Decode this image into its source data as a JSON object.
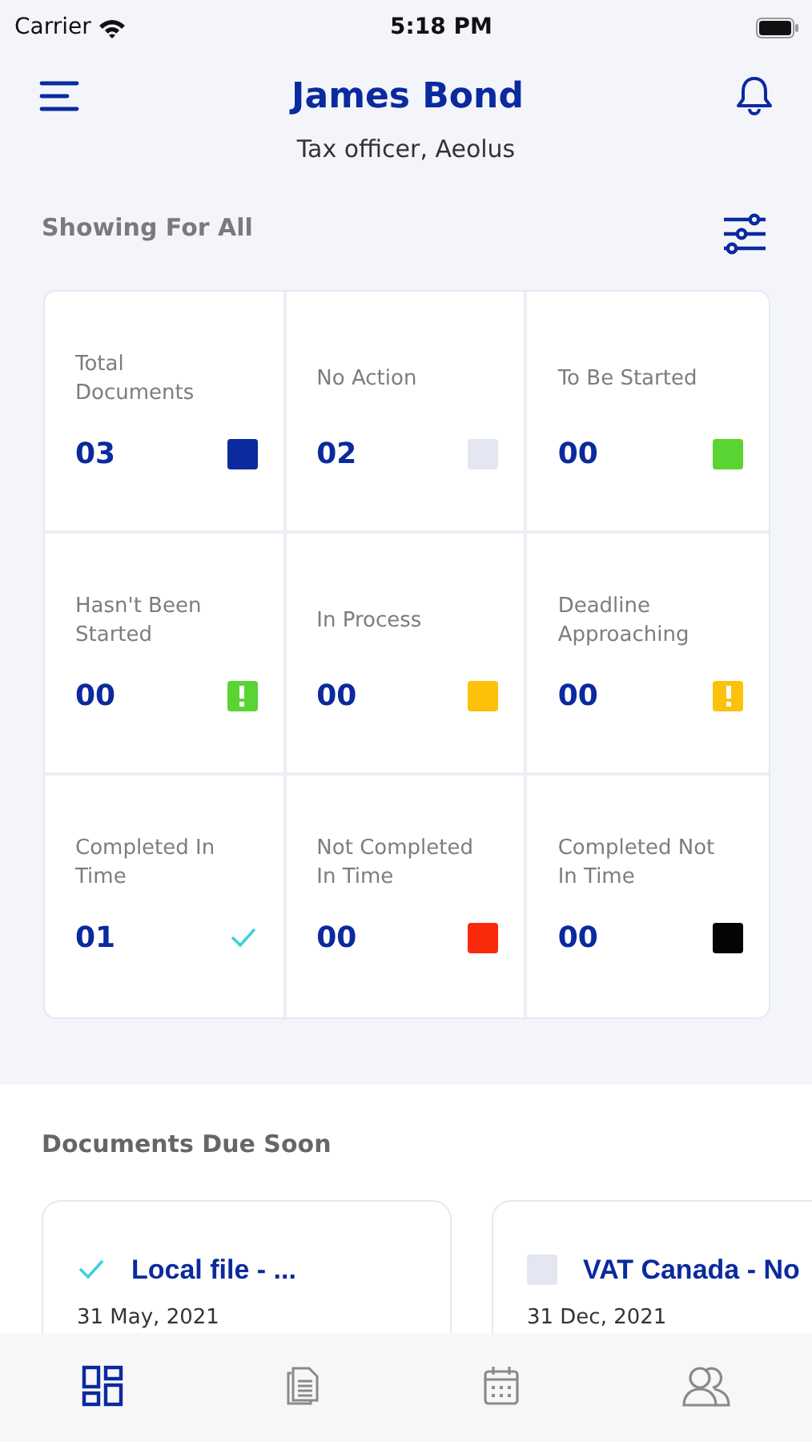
{
  "status_bar": {
    "carrier": "Carrier",
    "time": "5:18 PM"
  },
  "header": {
    "title": "James Bond",
    "subtitle": "Tax officer, Aeolus"
  },
  "filter_label": "Showing For All",
  "stats": [
    {
      "label": "Total Documents",
      "value": "03",
      "kind": "square",
      "color": "#0a2a9e"
    },
    {
      "label": "No Action",
      "value": "02",
      "kind": "square",
      "color": "#e4e6f2"
    },
    {
      "label": "To Be Started",
      "value": "00",
      "kind": "square",
      "color": "#5ad433"
    },
    {
      "label": "Hasn't Been Started",
      "value": "00",
      "kind": "alert",
      "color": "#5ad433"
    },
    {
      "label": "In Process",
      "value": "00",
      "kind": "square",
      "color": "#fcc10a"
    },
    {
      "label": "Deadline Approaching",
      "value": "00",
      "kind": "alert",
      "color": "#fcc10a"
    },
    {
      "label": "Completed In Time",
      "value": "01",
      "kind": "check",
      "color": "#3fd0dc"
    },
    {
      "label": "Not Completed In Time",
      "value": "00",
      "kind": "square",
      "color": "#f92b0c"
    },
    {
      "label": "Completed Not In Time",
      "value": "00",
      "kind": "square",
      "color": "#050505"
    }
  ],
  "due_section": {
    "title": "Documents Due Soon",
    "documents": [
      {
        "title": "Local file - ...",
        "date": "31 May, 2021",
        "kind": "check",
        "color": "#3fd0dc"
      },
      {
        "title": "VAT Canada - No",
        "date": "31 Dec, 2021",
        "kind": "square",
        "color": "#e4e6f2"
      }
    ]
  },
  "bottom_nav": [
    {
      "kind": "dashboard",
      "selected": true
    },
    {
      "kind": "documents",
      "selected": false
    },
    {
      "kind": "calendar",
      "selected": false
    },
    {
      "kind": "people",
      "selected": false
    }
  ]
}
